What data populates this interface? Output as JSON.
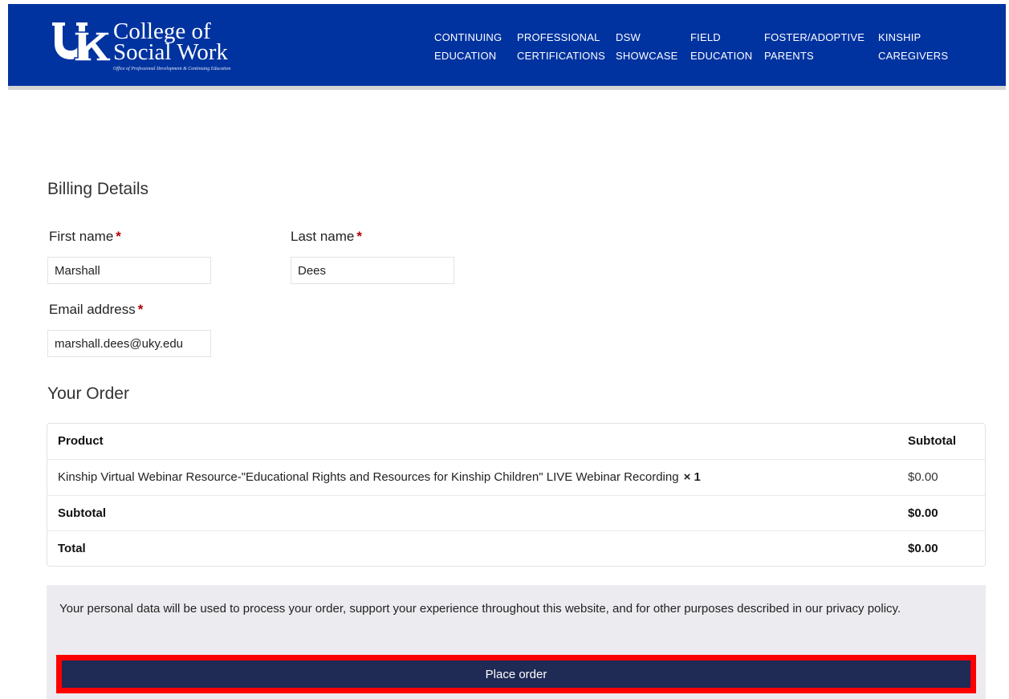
{
  "header": {
    "logo": {
      "line1": "College of",
      "line2": "Social Work",
      "subtitle": "Office of Professional Development & Continuing Education"
    },
    "nav": [
      {
        "line1": "CONTINUING",
        "line2": "EDUCATION"
      },
      {
        "line1": "PROFESSIONAL",
        "line2": "CERTIFICATIONS"
      },
      {
        "line1": "DSW",
        "line2": "SHOWCASE"
      },
      {
        "line1": "FIELD",
        "line2": "EDUCATION"
      },
      {
        "line1": "FOSTER/ADOPTIVE",
        "line2": "PARENTS"
      },
      {
        "line1": "KINSHIP",
        "line2": "CAREGIVERS"
      }
    ]
  },
  "billing": {
    "title": "Billing Details",
    "first_name": {
      "label": "First name",
      "required": "*",
      "value": "Marshall"
    },
    "last_name": {
      "label": "Last name",
      "required": "*",
      "value": "Dees"
    },
    "email": {
      "label": "Email address",
      "required": "*",
      "value": "marshall.dees@uky.edu"
    }
  },
  "order": {
    "title": "Your Order",
    "header": {
      "product": "Product",
      "subtotal": "Subtotal"
    },
    "items": [
      {
        "product": "Kinship Virtual Webinar Resource-\"Educational Rights and Resources for Kinship Children\" LIVE Webinar Recording",
        "qty": "× 1",
        "price": "$0.00"
      }
    ],
    "subtotal_label": "Subtotal",
    "subtotal_value": "$0.00",
    "total_label": "Total",
    "total_value": "$0.00"
  },
  "privacy": {
    "text": "Your personal data will be used to process your order, support your experience throughout this website, and for other purposes described in our ",
    "link": "privacy policy",
    "end": "."
  },
  "place_order_label": "Place order",
  "colors": {
    "header_bg": "#0033a0",
    "button_bg": "#1f2a55",
    "highlight": "#ff0000",
    "required": "#b00000"
  }
}
